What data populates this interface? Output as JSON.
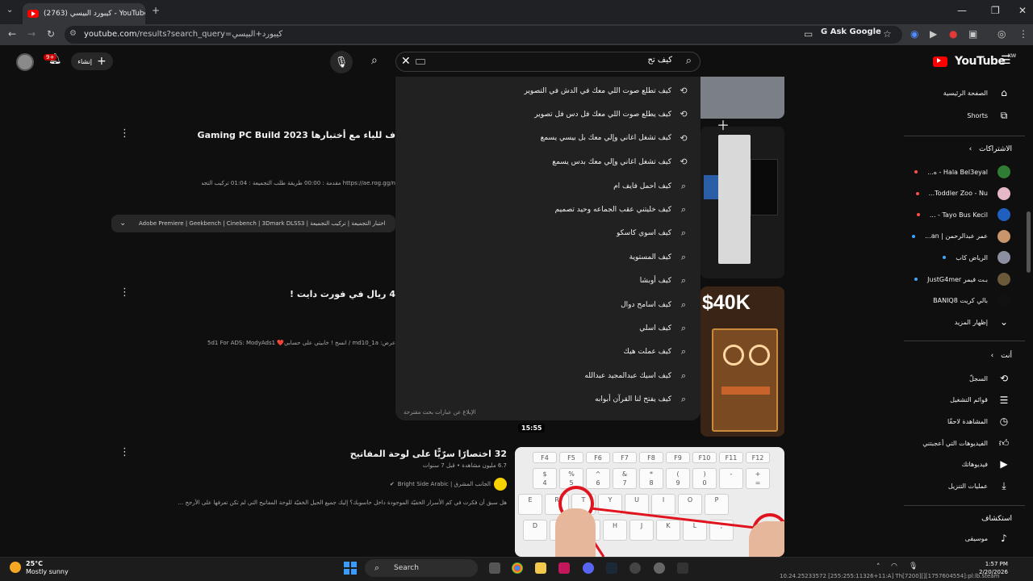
{
  "browser": {
    "tab_title": "(2763) كيبورد البيسي - YouTube",
    "url_host": "youtube.com",
    "url_path": "/results?search_query=كيبورد+البيسي",
    "ask_google": "Ask Google"
  },
  "header": {
    "search_value": "كيف تح",
    "create_label": "إنشاء",
    "bell_badge": "9+",
    "logo_text": "YouTube",
    "logo_region": "KW"
  },
  "suggestions": {
    "items": [
      {
        "text": "كيف تطلع صوت اللي معك في الدش في التصوير",
        "type": "history"
      },
      {
        "text": "كيف يطلع صوت اللي معك فل دس فل تصوير",
        "type": "history"
      },
      {
        "text": "كيف تشغل اغاني وإلي معك بل بيسي يسمع",
        "type": "history"
      },
      {
        "text": "كيف تشغل اغاني وإلي معك بدس يسمع",
        "type": "history"
      },
      {
        "text": "كيف احمل فايف ام",
        "type": "search"
      },
      {
        "text": "كيف خليتني عقب الجماعه وحيد تصميم",
        "type": "search"
      },
      {
        "text": "كيف اسوي كاسكو",
        "type": "search"
      },
      {
        "text": "كيف المستوية",
        "type": "search"
      },
      {
        "text": "كيف أوبشا",
        "type": "search"
      },
      {
        "text": "كيف اسامح دوال",
        "type": "search"
      },
      {
        "text": "كيف اسلي",
        "type": "search"
      },
      {
        "text": "كيف عملت هيك",
        "type": "search"
      },
      {
        "text": "كيف اسيك عبدالمجيد عبدالله",
        "type": "search"
      },
      {
        "text": "كيف يفتح لنا القرآن أبوابه",
        "type": "search"
      }
    ],
    "report_label": "الإبلاغ عن عبارات بحث مقترحة"
  },
  "results": [
    {
      "title": "ف للياء مع أختبارها Gaming PC Build 2023",
      "desc": "https://ae.rog.gg/n مقدمة : 00:00 طريقة طلب التجميعة : 01:04 تركيب التجميعة ...",
      "chapters": "Adobe Premiere | Geekbench | Cinebench | 3Dmark DLSS3 | اختبار التجميعة | تركيب التجميعة"
    },
    {
      "title": "4 ريال في فورت دايت !",
      "desc": "عرض: md10_1a / انسخ ! خابيتي على حسابي❤️ 5d1 For ADS: ModyAds1"
    },
    {
      "title": "32 اختصارًا سرّيًّا على لوحة المفاتيح",
      "views": "6.7 مليون مشاهدة • قبل 7 سنوات",
      "channel": "الجانب المشرق | Bright Side Arabic",
      "desc": "هل سبق أن فكرت في كم الأسرار الخفيّة الموجودة داخل حاسوبك؟ إليك جميع الحيل الخفيّة للوحة المفاتيح التي لم تكن تعرفها على الأرجح ...",
      "duration": "15:55"
    }
  ],
  "thumbs": {
    "price_text": "$40K",
    "keys_row1": [
      "F4",
      "F5",
      "F6",
      "F7",
      "F8",
      "F9",
      "F10",
      "F11",
      "F12"
    ],
    "keys_row2": [
      "$\n4",
      "%\n5",
      "^\n6",
      "&\n7",
      "*\n8",
      "(\n9",
      ")\n0",
      "-",
      "+\n="
    ],
    "keys_row3": [
      "E",
      "R",
      "T",
      "Y",
      "U",
      "I",
      "O",
      "P"
    ],
    "keys_row4": [
      "D",
      "F",
      "G",
      "H",
      "J",
      "K",
      "L",
      ";"
    ]
  },
  "sidebar": {
    "home": "الصفحة الرئيسية",
    "shorts": "Shorts",
    "subs_head": "الاشتراكات",
    "channels": [
      {
        "name": "Hala Bel3eyal - ه...",
        "color": "#2e7d32",
        "dot": "red"
      },
      {
        "name": "Toddler Zoo - Nu...",
        "color": "#e6b8c8",
        "dot": "red"
      },
      {
        "name": "Tayo Bus Kecil - ...",
        "color": "#1e5fbf",
        "dot": "red"
      },
      {
        "name": "عمر عبدالرحمن | an...",
        "color": "#c9956b",
        "dot": "blue"
      },
      {
        "name": "الرياض كاب",
        "color": "#8b8fa0",
        "dot": "blue"
      },
      {
        "name": "بـت فيمر JustG4mer",
        "color": "#6a5a3a",
        "dot": "blue"
      },
      {
        "name": "بالي كريت BANIQ8",
        "color": "#111111",
        "dot": ""
      }
    ],
    "show_more": "إظهار المزيد",
    "you_head": "أنت",
    "you_items": [
      {
        "label": "السجلّ",
        "icon": "history-icon"
      },
      {
        "label": "قوائم التشغيل",
        "icon": "playlist-icon"
      },
      {
        "label": "المشاهدة لاحقًا",
        "icon": "clock-icon"
      },
      {
        "label": "الفيديوهات التي أعجبتني",
        "icon": "thumbs-up-icon"
      },
      {
        "label": "فيديوهاتك",
        "icon": "your-videos-icon"
      },
      {
        "label": "عمليات التنزيل",
        "icon": "download-icon"
      }
    ],
    "explore_head": "استكشاف",
    "music": "موسيقى"
  },
  "taskbar": {
    "temp": "25°C",
    "weather": "Mostly sunny",
    "search": "Search",
    "time": "1:57 PM",
    "date": "2/20/2026",
    "overlay": "10.24.25233572 [255:255:11326+11:A] Th[7200][][1757604554]:pl:lb.steam"
  }
}
